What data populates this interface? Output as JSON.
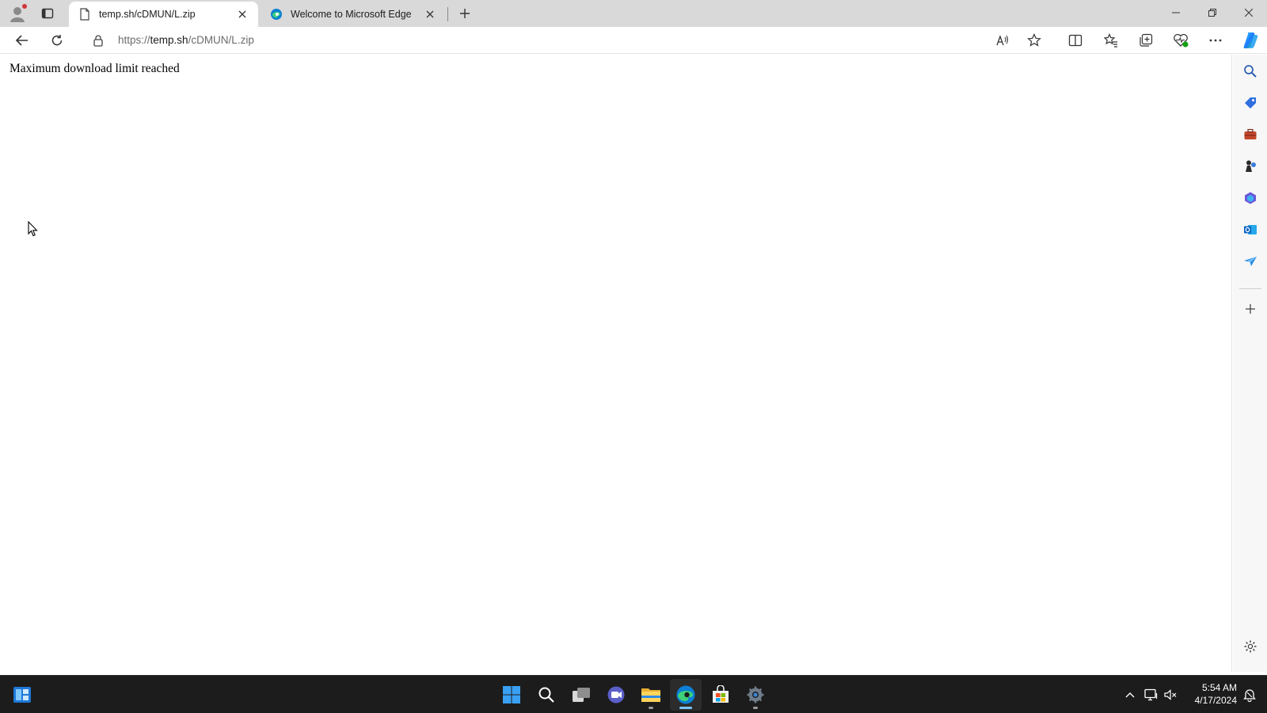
{
  "browser": {
    "tabs": [
      {
        "title": "temp.sh/cDMUN/L.zip",
        "active": true,
        "favicon": "page-icon"
      },
      {
        "title": "Welcome to Microsoft Edge",
        "active": false,
        "favicon": "edge-logo-icon"
      }
    ],
    "address": {
      "prefix": "https://",
      "host": "temp.sh",
      "path": "/cDMUN/L.zip"
    },
    "toolbar_icons": [
      "back-arrow-icon",
      "refresh-icon",
      "read-aloud-icon",
      "favorite-star-icon",
      "split-screen-icon",
      "favorites-icon",
      "collections-icon",
      "browser-essentials-icon",
      "more-icon",
      "copilot-icon"
    ],
    "window_controls": [
      "minimize-icon",
      "restore-icon",
      "close-icon"
    ]
  },
  "page": {
    "message": "Maximum download limit reached"
  },
  "sidebar": {
    "icons": [
      "search-icon",
      "shopping-tag-icon",
      "tools-briefcase-icon",
      "games-icon",
      "microsoft-365-icon",
      "outlook-icon",
      "drop-icon",
      "add-icon",
      "settings-gear-icon"
    ]
  },
  "taskbar": {
    "apps": [
      "widgets-icon",
      "start-windows-icon",
      "search-icon",
      "task-view-icon",
      "teams-chat-icon",
      "file-explorer-icon",
      "edge-icon",
      "store-icon",
      "settings-icon"
    ],
    "clock": {
      "time": "5:54 AM",
      "date": "4/17/2024"
    }
  },
  "colors": {
    "tabstrip_bg": "#d9d9d9",
    "taskbar_bg": "#1c1c1c",
    "accent_blue": "#0078d4"
  }
}
